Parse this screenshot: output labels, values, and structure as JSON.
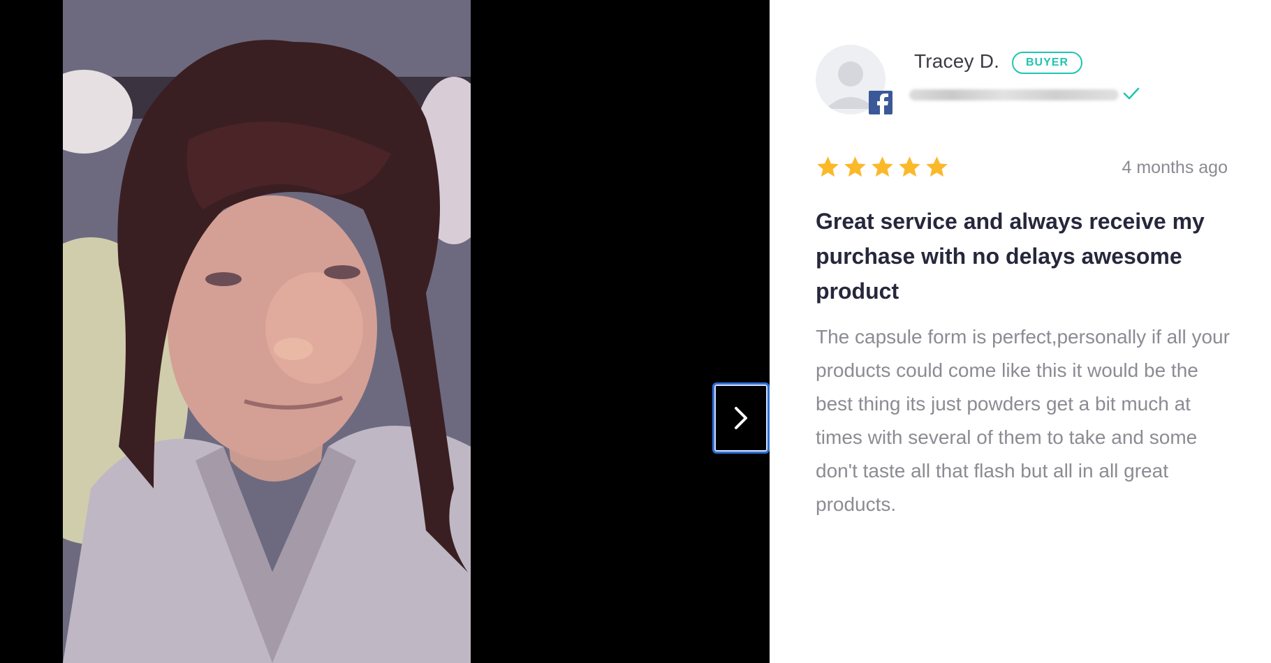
{
  "review": {
    "reviewer_name": "Tracey D.",
    "badge": "BUYER",
    "social_source_icon": "facebook-icon",
    "verified_icon": "check-icon",
    "rating": 5,
    "rating_max": 5,
    "date": "4 months ago",
    "title": "Great service and always receive my purchase with no delays awesome product",
    "body": "The capsule form is perfect,personally if all your products could come like this it would be the best thing its just powders get a bit much at times with several of them to take and some don't taste all that flash but all in all great products."
  },
  "navigation": {
    "next_icon": "chevron-right-icon"
  },
  "colors": {
    "accent_teal": "#1fc4b0",
    "star_gold": "#fbb829",
    "title_text": "#26273b",
    "body_text": "#8b8b93",
    "facebook_blue": "#3b5998",
    "focus_blue": "#2f6fd6"
  }
}
